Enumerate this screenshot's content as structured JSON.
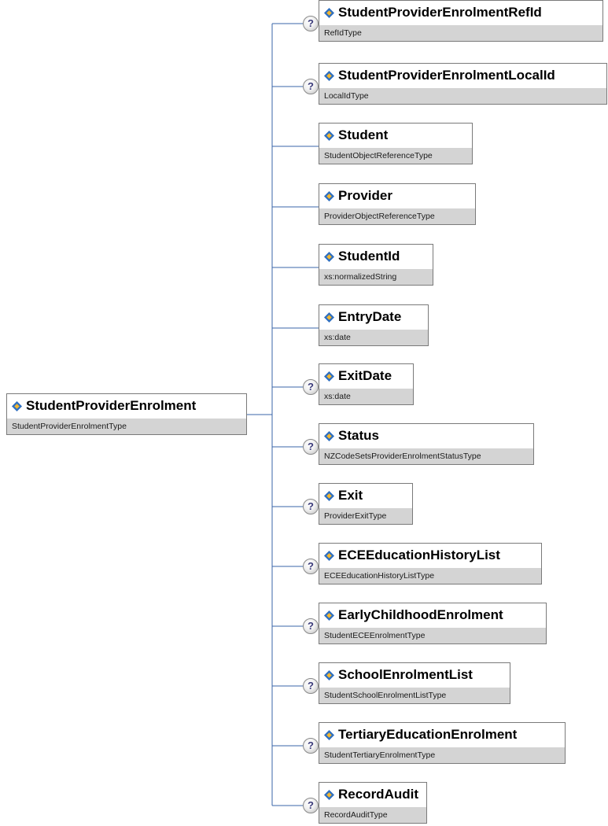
{
  "root": {
    "name": "StudentProviderEnrolment",
    "type": "StudentProviderEnrolmentType"
  },
  "optional_marker": "?",
  "children": [
    {
      "name": "StudentProviderEnrolmentRefId",
      "type": "RefIdType",
      "optional": true
    },
    {
      "name": "StudentProviderEnrolmentLocalId",
      "type": "LocalIdType",
      "optional": true
    },
    {
      "name": "Student",
      "type": "StudentObjectReferenceType",
      "optional": false
    },
    {
      "name": "Provider",
      "type": "ProviderObjectReferenceType",
      "optional": false
    },
    {
      "name": "StudentId",
      "type": "xs:normalizedString",
      "optional": false
    },
    {
      "name": "EntryDate",
      "type": "xs:date",
      "optional": false
    },
    {
      "name": "ExitDate",
      "type": "xs:date",
      "optional": true
    },
    {
      "name": "Status",
      "type": "NZCodeSetsProviderEnrolmentStatusType",
      "optional": true
    },
    {
      "name": "Exit",
      "type": "ProviderExitType",
      "optional": true
    },
    {
      "name": "ECEEducationHistoryList",
      "type": "ECEEducationHistoryListType",
      "optional": true
    },
    {
      "name": "EarlyChildhoodEnrolment",
      "type": "StudentECEEnrolmentType",
      "optional": true
    },
    {
      "name": "SchoolEnrolmentList",
      "type": "StudentSchoolEnrolmentListType",
      "optional": true
    },
    {
      "name": "TertiaryEducationEnrolment",
      "type": "StudentTertiaryEnrolmentType",
      "optional": true
    },
    {
      "name": "RecordAudit",
      "type": "RecordAuditType",
      "optional": true
    }
  ],
  "colors": {
    "connector": "#3a64a8",
    "type_band": "#d4d4d4",
    "border": "#7a7a7a",
    "icon_blue": "#2e6fc0",
    "icon_gold": "#f2b630"
  }
}
